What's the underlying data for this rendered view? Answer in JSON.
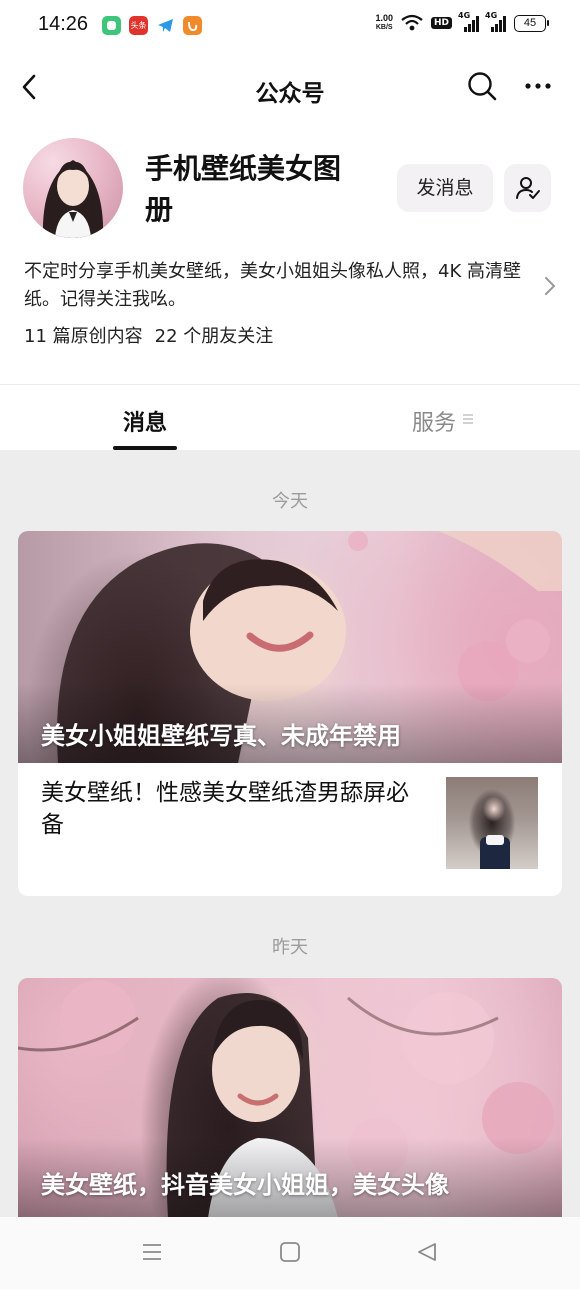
{
  "status_bar": {
    "time": "14:26",
    "apps": [
      {
        "icon": "wechat-mini-icon",
        "color": "#3dc57b"
      },
      {
        "icon": "toutiao-icon",
        "color": "#e0332b",
        "text": "头条"
      },
      {
        "icon": "telegram-icon",
        "color": "#2a9ae6"
      },
      {
        "icon": "uc-browser-icon",
        "color": "#f18a2b"
      }
    ],
    "net_speed_value": "1.00",
    "net_speed_unit": "KB/S",
    "hd_badge": "HD",
    "signal1_label": "4G",
    "signal2_label": "4G",
    "battery": "45"
  },
  "nav": {
    "title": "公众号"
  },
  "profile": {
    "name": "手机壁纸美女图册",
    "message_button": "发消息",
    "description": "不定时分享手机美女壁纸，美女小姐姐头像私人照，4K 高清壁纸。记得关注我吆。",
    "stats_original": "11 篇原创内容",
    "stats_friends": "22 个朋友关注"
  },
  "tabs": {
    "messages": "消息",
    "services": "服务"
  },
  "feed": {
    "groups": [
      {
        "date": "今天",
        "cover_title": "美女小姐姐壁纸写真、未成年禁用",
        "sub_title": "美女壁纸！性感美女壁纸渣男舔屏必备"
      },
      {
        "date": "昨天",
        "cover_title": "美女壁纸，抖音美女小姐姐，美女头像"
      }
    ]
  }
}
